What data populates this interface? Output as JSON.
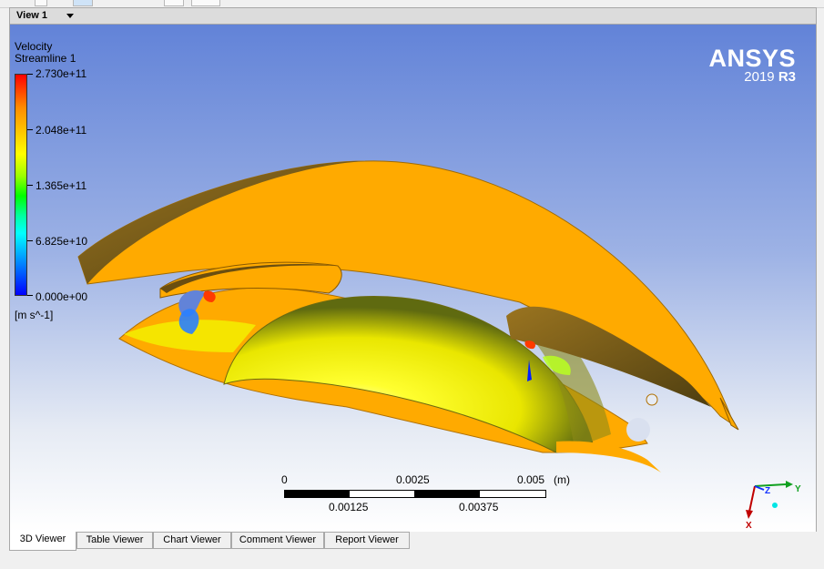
{
  "window": {
    "view_title": "View 1"
  },
  "legend": {
    "title_line1": "Velocity",
    "title_line2": "Streamline 1",
    "ticks": [
      "2.730e+11",
      "2.048e+11",
      "1.365e+11",
      "6.825e+10",
      "0.000e+00"
    ],
    "units": "[m s^-1]"
  },
  "brand": {
    "name": "ANSYS",
    "version_year": "2019",
    "version_release": "R3"
  },
  "scale_bar": {
    "top_labels": [
      "0",
      "0.0025",
      "0.005"
    ],
    "unit": "(m)",
    "bottom_labels": [
      "0.00125",
      "0.00375"
    ]
  },
  "triad": {
    "axis_y": "Y",
    "axis_z": "Z",
    "axis_x": "X"
  },
  "tabs": [
    {
      "label": "3D Viewer",
      "active": true
    },
    {
      "label": "Table Viewer",
      "active": false
    },
    {
      "label": "Chart Viewer",
      "active": false
    },
    {
      "label": "Comment Viewer",
      "active": false
    },
    {
      "label": "Report Viewer",
      "active": false
    }
  ],
  "colors": {
    "blade": "#ffaa00",
    "blade_shadow": "#7a5a10",
    "hub": "#f2ef00",
    "background_top": "#6283d8"
  }
}
